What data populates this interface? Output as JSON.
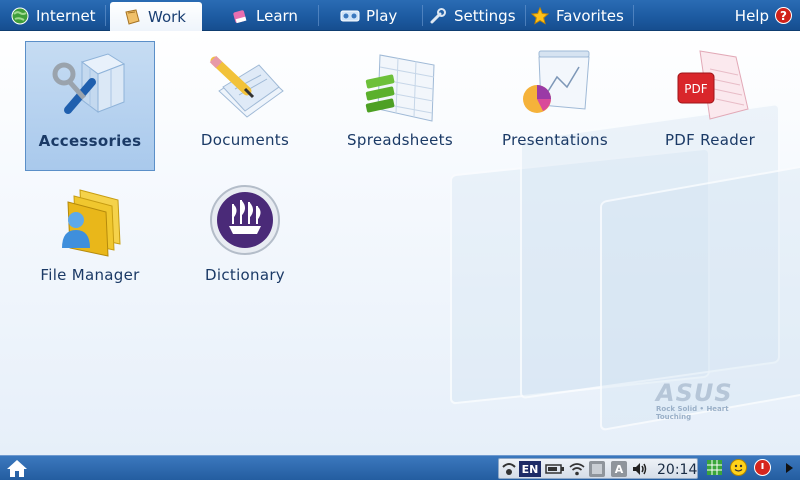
{
  "tabs": [
    {
      "label": "Internet",
      "icon": "globe-icon"
    },
    {
      "label": "Work",
      "icon": "briefcase-icon",
      "active": true
    },
    {
      "label": "Learn",
      "icon": "eraser-icon"
    },
    {
      "label": "Play",
      "icon": "media-icon"
    },
    {
      "label": "Settings",
      "icon": "wrench-icon"
    },
    {
      "label": "Favorites",
      "icon": "star-icon"
    }
  ],
  "help": {
    "label": "Help",
    "badge": "?"
  },
  "apps": [
    {
      "label": "Accessories",
      "icon": "accessories-icon",
      "selected": true
    },
    {
      "label": "Documents",
      "icon": "documents-icon"
    },
    {
      "label": "Spreadsheets",
      "icon": "spreadsheets-icon"
    },
    {
      "label": "Presentations",
      "icon": "presentations-icon"
    },
    {
      "label": "PDF Reader",
      "icon": "pdf-reader-icon",
      "badge": "PDF"
    },
    {
      "label": "File Manager",
      "icon": "file-manager-icon"
    },
    {
      "label": "Dictionary",
      "icon": "dictionary-icon"
    }
  ],
  "branding": {
    "logo": "ASUS",
    "tagline": "Rock Solid • Heart Touching"
  },
  "taskbar": {
    "language": "EN",
    "clock": "20:14",
    "tray_letters": {
      "a": "A"
    }
  },
  "colors": {
    "topbar": "#1c5aa0",
    "accent": "#2a6cb4",
    "label": "#1b3a66",
    "selected": "#a9c9ec"
  }
}
